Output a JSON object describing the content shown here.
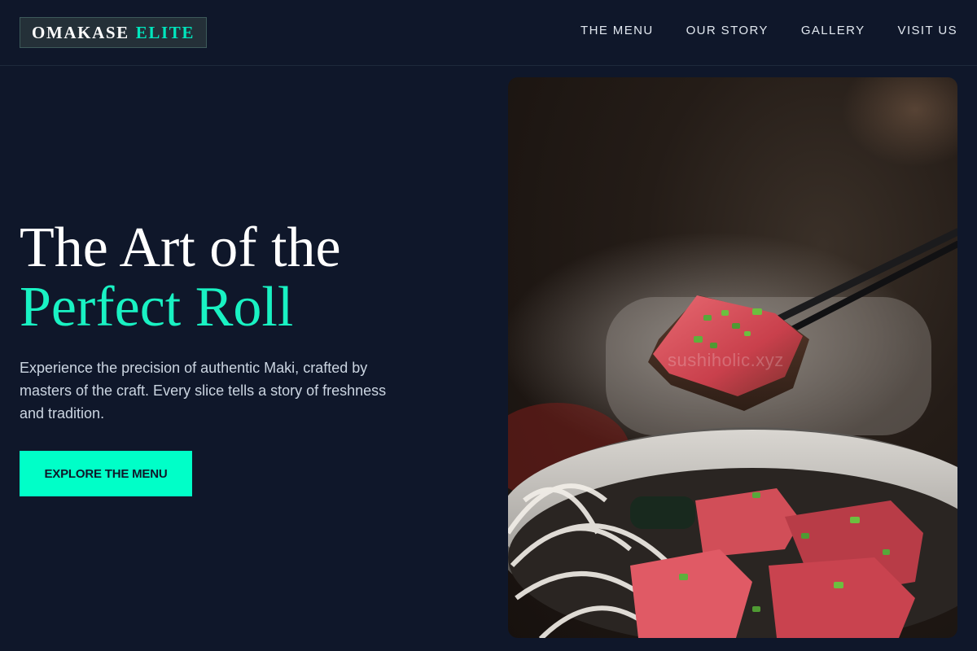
{
  "nav": {
    "logo": {
      "word1": "OMAKASE",
      "word2": "ELITE"
    },
    "links": [
      "THE MENU",
      "OUR STORY",
      "GALLERY",
      "VISIT US"
    ]
  },
  "hero": {
    "title_line1": "The Art of the",
    "title_line2": "Perfect Roll",
    "description": "Experience the precision of authentic Maki, crafted by masters of the craft. Every slice tells a story of freshness and tradition.",
    "cta_label": "EXPLORE THE MENU"
  },
  "image": {
    "watermark": "sushiholic.xyz",
    "subject": "seared tuna slice held by chopsticks above a bowl of tataki with onion and chives"
  },
  "colors": {
    "background": "#0f172a",
    "accent": "#00ffc8",
    "accent_text": "#19f2c3",
    "nav_text": "#e2e8f0",
    "body_text": "#cbd5e1"
  }
}
